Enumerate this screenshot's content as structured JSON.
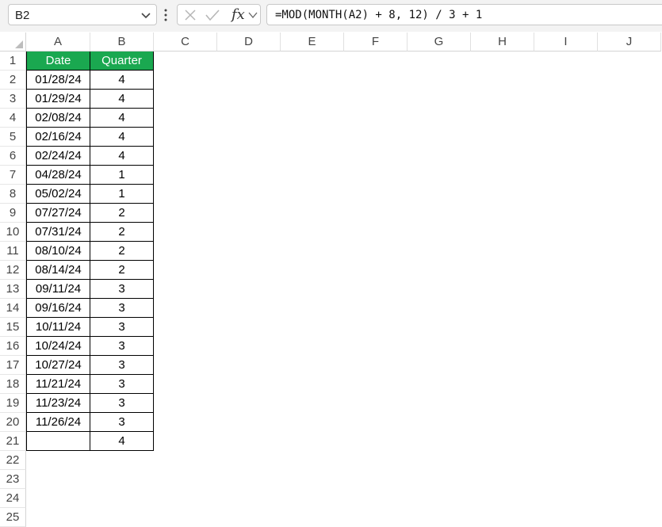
{
  "name_box": {
    "value": "B2"
  },
  "formula_bar": {
    "formula": "=MOD(MONTH(A2) + 8, 12) / 3 + 1",
    "fx_label": "fx"
  },
  "columns": [
    "A",
    "B",
    "C",
    "D",
    "E",
    "F",
    "G",
    "H",
    "I",
    "J"
  ],
  "row_numbers": [
    "1",
    "2",
    "3",
    "4",
    "5",
    "6",
    "7",
    "8",
    "9",
    "10",
    "11",
    "12",
    "13",
    "14",
    "15",
    "16",
    "17",
    "18",
    "19",
    "20",
    "21",
    "22",
    "23",
    "24",
    "25"
  ],
  "table": {
    "headers": [
      "Date",
      "Quarter"
    ],
    "header_color": "#1aa850",
    "rows": [
      [
        "01/28/24",
        "4"
      ],
      [
        "01/29/24",
        "4"
      ],
      [
        "02/08/24",
        "4"
      ],
      [
        "02/16/24",
        "4"
      ],
      [
        "02/24/24",
        "4"
      ],
      [
        "04/28/24",
        "1"
      ],
      [
        "05/02/24",
        "1"
      ],
      [
        "07/27/24",
        "2"
      ],
      [
        "07/31/24",
        "2"
      ],
      [
        "08/10/24",
        "2"
      ],
      [
        "08/14/24",
        "2"
      ],
      [
        "09/11/24",
        "3"
      ],
      [
        "09/16/24",
        "3"
      ],
      [
        "10/11/24",
        "3"
      ],
      [
        "10/24/24",
        "3"
      ],
      [
        "10/27/24",
        "3"
      ],
      [
        "11/21/24",
        "3"
      ],
      [
        "11/23/24",
        "3"
      ],
      [
        "11/26/24",
        "3"
      ],
      [
        "",
        "4"
      ]
    ]
  }
}
